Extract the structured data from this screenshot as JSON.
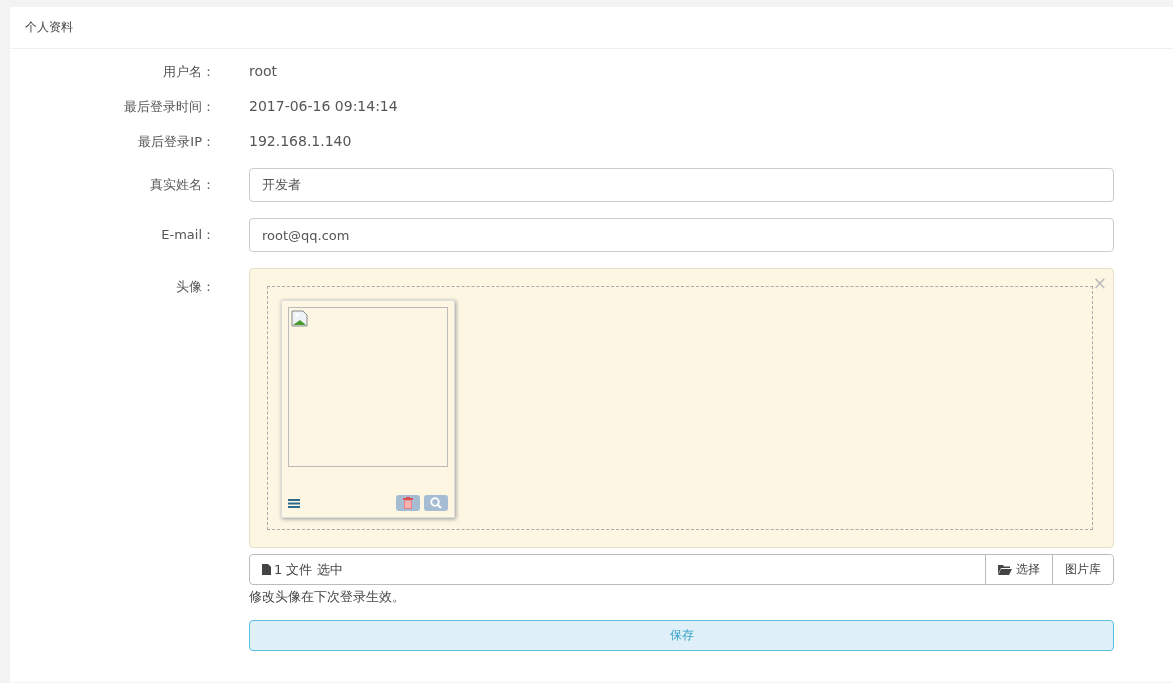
{
  "panel": {
    "title": "个人资料"
  },
  "info_rows": [
    {
      "label": "用户名：",
      "value": "root"
    },
    {
      "label": "最后登录时间：",
      "value": "2017-06-16 09:14:14"
    },
    {
      "label": "最后登录IP：",
      "value": "192.168.1.140"
    }
  ],
  "fields": [
    {
      "label": "真实姓名：",
      "value": "开发者"
    },
    {
      "label": "E-mail：",
      "value": "root@qq.com"
    }
  ],
  "avatar": {
    "label": "头像：",
    "close": "×",
    "caption": "1 文件 选中",
    "browse": "选择",
    "gallery": "图片库"
  },
  "hint": "修改头像在下次登录生效。",
  "save": "保存"
}
